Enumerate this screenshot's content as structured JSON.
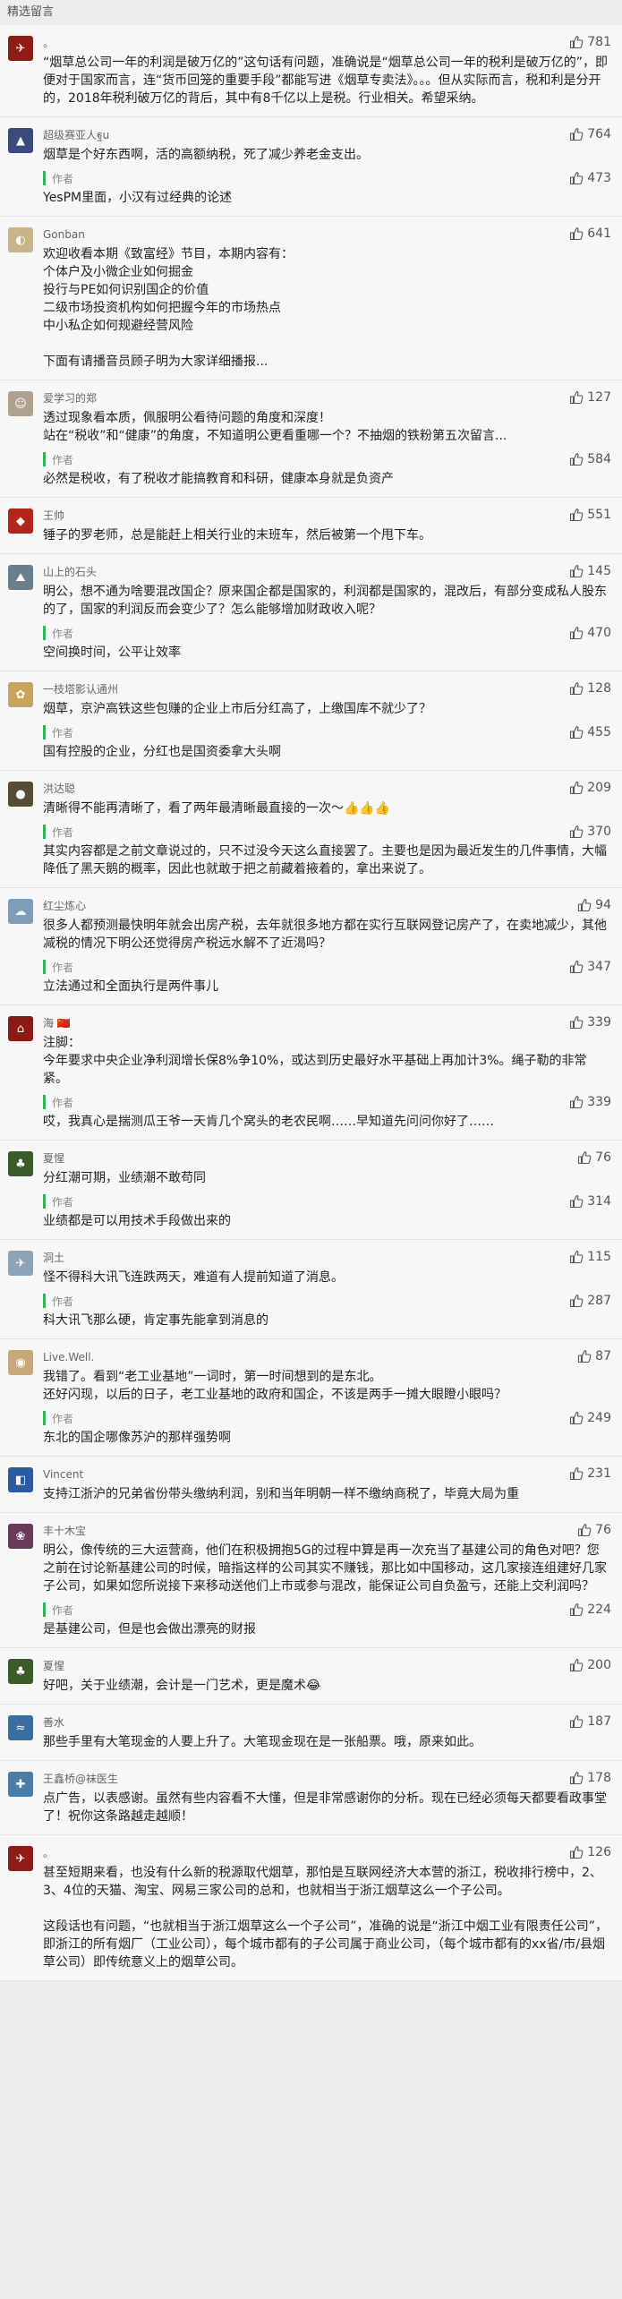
{
  "section": {
    "title": "精选留言"
  },
  "comments": [
    {
      "nickname": "。",
      "likes": "781",
      "avatar_color": "#8e1b16",
      "avatar_glyph": "✈",
      "text": "“烟草总公司一年的利润是破万亿的”这句话有问题，准确说是“烟草总公司一年的税利是破万亿的”，即便对于国家而言，连“货币回笼的重要手段”都能写进《烟草专卖法》。。。但从实际而言，税和利是分开的，2018年税利破万亿的背后，其中有8千亿以上是税。行业相关。希望采纳。",
      "reply": null
    },
    {
      "nickname": "超级赛亚人ฐu",
      "likes": "764",
      "avatar_color": "#3b4a7a",
      "avatar_glyph": "▲",
      "text": "烟草是个好东西啊，活的高额纳税，死了减少养老金支出。",
      "reply": {
        "tag": "作者",
        "likes": "473",
        "text": "YesPM里面，小汉有过经典的论述"
      }
    },
    {
      "nickname": "Gonban",
      "likes": "641",
      "avatar_color": "#c9b48a",
      "avatar_glyph": "◐",
      "text": "欢迎收看本期《致富经》节目，本期内容有：\n个体户及小微企业如何掘金\n投行与PE如何识别国企的价值\n二级市场投资机构如何把握今年的市场热点\n中小私企如何规避经营风险\n\n下面有请播音员顾子明为大家详细播报...",
      "reply": null
    },
    {
      "nickname": "爱学习的郑",
      "likes": "127",
      "avatar_color": "#b0a090",
      "avatar_glyph": "☺",
      "text": "透过现象看本质，佩服明公看待问题的角度和深度！\n站在“税收”和“健康”的角度，不知道明公更看重哪一个？不抽烟的铁粉第五次留言...",
      "reply": {
        "tag": "作者",
        "likes": "584",
        "text": "必然是税收，有了税收才能搞教育和科研，健康本身就是负资产"
      }
    },
    {
      "nickname": "王帅",
      "likes": "551",
      "avatar_color": "#b3241c",
      "avatar_glyph": "◆",
      "text": "锤子的罗老师，总是能赶上相关行业的末班车，然后被第一个甩下车。",
      "reply": null
    },
    {
      "nickname": "山上的石头",
      "likes": "145",
      "avatar_color": "#6a7e8c",
      "avatar_glyph": "⛰",
      "text": "明公，想不通为啥要混改国企？原来国企都是国家的，利润都是国家的，混改后，有部分变成私人股东的了，国家的利润反而会变少了？怎么能够增加财政收入呢？",
      "reply": {
        "tag": "作者",
        "likes": "470",
        "text": "空间换时间，公平让效率"
      }
    },
    {
      "nickname": "一枝塔影认通州",
      "likes": "128",
      "avatar_color": "#c9a45c",
      "avatar_glyph": "✿",
      "text": "烟草，京沪高铁这些包赚的企业上市后分红高了，上缴国库不就少了？",
      "reply": {
        "tag": "作者",
        "likes": "455",
        "text": "国有控股的企业，分红也是国资委拿大头啊"
      }
    },
    {
      "nickname": "洪达聪",
      "likes": "209",
      "avatar_color": "#5a4a3a",
      "avatar_glyph": "●",
      "text": "清晰得不能再清晰了，看了两年最清晰最直接的一次～👍👍👍",
      "reply": {
        "tag": "作者",
        "likes": "370",
        "text": "其实内容都是之前文章说过的，只不过没今天这么直接罢了。主要也是因为最近发生的几件事情，大幅降低了黑天鹅的概率，因此也就敢于把之前藏着掖着的，拿出来说了。"
      }
    },
    {
      "nickname": "红尘炼心",
      "likes": "94",
      "avatar_color": "#7f9cb8",
      "avatar_glyph": "☁",
      "text": "很多人都预测最快明年就会出房产税，去年就很多地方都在实行互联网登记房产了，在卖地减少，其他减税的情况下明公还觉得房产税远水解不了近渴吗？",
      "reply": {
        "tag": "作者",
        "likes": "347",
        "text": "立法通过和全面执行是两件事儿"
      }
    },
    {
      "nickname": "海 🇨🇳",
      "likes": "339",
      "avatar_color": "#8a1a14",
      "avatar_glyph": "⌂",
      "text": "注脚：\n今年要求中央企业净利润增长保8%争10%，或达到历史最好水平基础上再加计3%。绳子勒的非常紧。",
      "reply": {
        "tag": "作者",
        "likes": "339",
        "text": "哎，我真心是揣测瓜王爷一天肯几个窝头的老农民啊……早知道先问问你好了……"
      }
    },
    {
      "nickname": "夏惺",
      "likes": "76",
      "avatar_color": "#3c5a2a",
      "avatar_glyph": "♣",
      "text": "分红潮可期，业绩潮不敢苟同",
      "reply": {
        "tag": "作者",
        "likes": "314",
        "text": "业绩都是可以用技术手段做出来的"
      }
    },
    {
      "nickname": "洞土",
      "likes": "115",
      "avatar_color": "#8fa3b8",
      "avatar_glyph": "✈",
      "text": "怪不得科大讯飞连跌两天，难道有人提前知道了消息。",
      "reply": {
        "tag": "作者",
        "likes": "287",
        "text": "科大讯飞那么硬，肯定事先能拿到消息的"
      }
    },
    {
      "nickname": "Live.Well.",
      "likes": "87",
      "avatar_color": "#c8a878",
      "avatar_glyph": "◉",
      "text": "我错了。看到“老工业基地”一词时，第一时间想到的是东北。\n还好闪现，以后的日子，老工业基地的政府和国企，不该是两手一摊大眼瞪小眼吗？",
      "reply": {
        "tag": "作者",
        "likes": "249",
        "text": "东北的国企哪像苏沪的那样强势啊"
      }
    },
    {
      "nickname": "Vincent",
      "likes": "231",
      "avatar_color": "#2c5aa0",
      "avatar_glyph": "◧",
      "text": "支持江浙沪的兄弟省份带头缴纳利润，别和当年明朝一样不缴纳商税了，毕竟大局为重",
      "reply": null
    },
    {
      "nickname": "丰十木宝",
      "likes": "76",
      "avatar_color": "#6b3a5a",
      "avatar_glyph": "❀",
      "text": "明公，像传统的三大运营商，他们在积极拥抱5G的过程中算是再一次充当了基建公司的角色对吧？您之前在讨论新基建公司的时候，暗指这样的公司其实不赚钱，那比如中国移动，这几家接连组建好几家子公司，如果如您所说接下来移动送他们上市或参与混改，能保证公司自负盈亏，还能上交利润吗？",
      "reply": {
        "tag": "作者",
        "likes": "224",
        "text": "是基建公司，但是也会做出漂亮的财报"
      }
    },
    {
      "nickname": "夏惺",
      "likes": "200",
      "avatar_color": "#3c5a2a",
      "avatar_glyph": "♣",
      "text": "好吧，关于业绩潮，会计是一门艺术，更是魔术😂",
      "reply": null
    },
    {
      "nickname": "善水",
      "likes": "187",
      "avatar_color": "#3a6ea0",
      "avatar_glyph": "≈",
      "text": "那些手里有大笔现金的人要上升了。大笔现金现在是一张船票。哦，原来如此。",
      "reply": null
    },
    {
      "nickname": "王鑫桥@袜医生",
      "likes": "178",
      "avatar_color": "#4a7ea8",
      "avatar_glyph": "✚",
      "text": "点广告，以表感谢。虽然有些内容看不大懂，但是非常感谢你的分析。现在已经必须每天都要看政事堂了！祝你这条路越走越顺！",
      "reply": null
    },
    {
      "nickname": "。",
      "likes": "126",
      "avatar_color": "#8e1b16",
      "avatar_glyph": "✈",
      "text": "甚至短期来看，也没有什么新的税源取代烟草，那怕是互联网经济大本营的浙江，税收排行榜中，2、3、4位的天猫、淘宝、网易三家公司的总和，也就相当于浙江烟草这么一个子公司。\n\n这段话也有问题，“也就相当于浙江烟草这么一个子公司”，准确的说是“浙江中烟工业有限责任公司”，即浙江的所有烟厂（工业公司），每个城市都有的子公司属于商业公司，（每个城市都有的xx省/市/县烟草公司）即传统意义上的烟草公司。",
      "reply": null
    }
  ]
}
